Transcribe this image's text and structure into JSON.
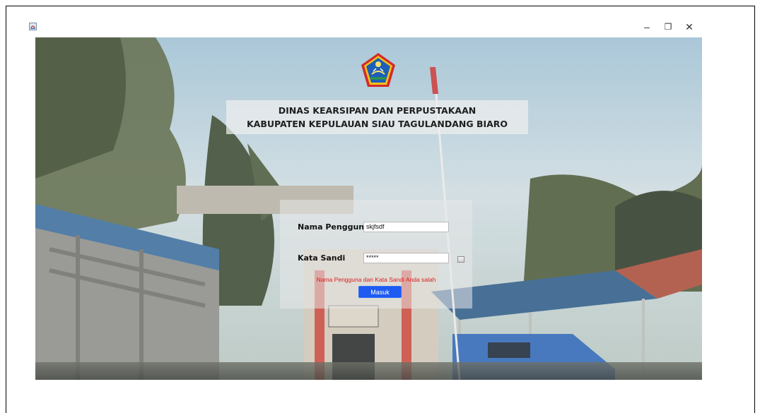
{
  "window": {
    "controls": {
      "minimize": "–",
      "maximize": "❐",
      "close": "✕"
    }
  },
  "header": {
    "title_line1": "DINAS KEARSIPAN DAN PERPUSTAKAAN",
    "title_line2": "KABUPATEN KEPULAUAN SIAU TAGULANDANG BIARO"
  },
  "login": {
    "username_label": "Nama Pengguna",
    "username_value": "skjfsdf",
    "password_label": "Kata Sandi",
    "password_value": "*****",
    "error_message": "Nama Pengguna dan Kata Sandi Anda salah",
    "submit_label": "Masuk"
  },
  "colors": {
    "accent": "#1f5bf2",
    "error": "#d81c1c"
  },
  "icons": [
    "java-app-icon",
    "minimize-icon",
    "restore-icon",
    "close-icon",
    "regency-emblem-icon",
    "show-password-icon"
  ]
}
